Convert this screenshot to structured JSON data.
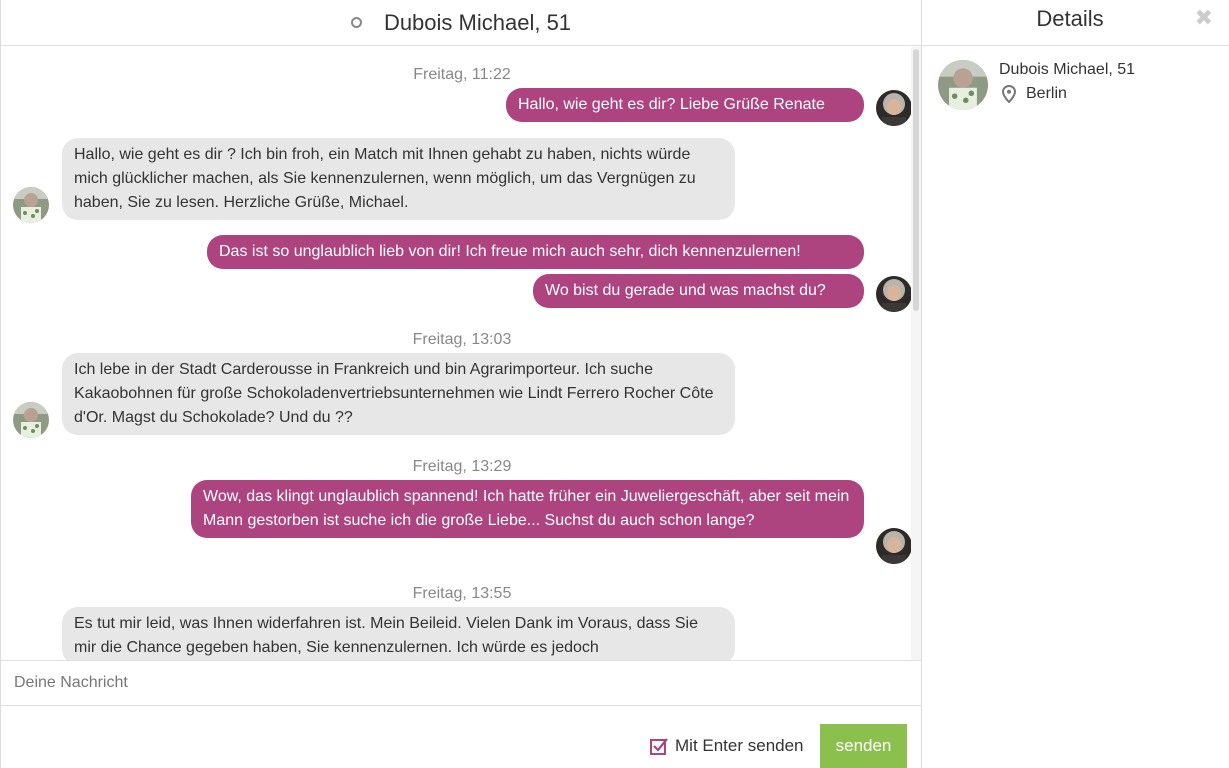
{
  "chat": {
    "title": "Dubois Michael, 51",
    "status_icon": "offline-circle-icon"
  },
  "messages": [
    {
      "type": "timestamp",
      "text": "Freitag, 11:22"
    },
    {
      "type": "outgoing",
      "text": "Hallo, wie geht es dir? Liebe Grüße Renate"
    },
    {
      "type": "incoming",
      "text": "Hallo, wie geht es dir ? Ich bin froh, ein Match mit Ihnen gehabt zu haben, nichts würde mich glücklicher machen, als Sie kennenzulernen, wenn möglich, um das Vergnügen zu haben, Sie zu lesen. Herzliche Grüße, Michael."
    },
    {
      "type": "outgoing",
      "text": "Das ist so unglaublich lieb von dir! Ich freue mich auch sehr, dich kennenzulernen!"
    },
    {
      "type": "outgoing",
      "text": "Wo bist du gerade und was machst du?"
    },
    {
      "type": "timestamp",
      "text": "Freitag, 13:03"
    },
    {
      "type": "incoming",
      "text": "Ich lebe in der Stadt Carderousse in Frankreich und bin Agrarimporteur. Ich suche Kakaobohnen für große Schokoladenvertriebsunternehmen wie Lindt Ferrero Rocher Côte d'Or. Magst du Schokolade? Und du ??"
    },
    {
      "type": "timestamp",
      "text": "Freitag, 13:29"
    },
    {
      "type": "outgoing",
      "text": "Wow, das klingt unglaublich spannend! Ich hatte früher ein Juweliergeschäft, aber seit mein Mann gestorben ist suche ich die große Liebe... Suchst du auch schon lange?"
    },
    {
      "type": "timestamp",
      "text": "Freitag, 13:55"
    },
    {
      "type": "incoming",
      "text": "Es tut mir leid, was Ihnen widerfahren ist. Mein Beileid. Vielen Dank im Voraus, dass Sie mir die Chance gegeben haben, Sie kennenzulernen. Ich würde es jedoch"
    }
  ],
  "compose": {
    "placeholder": "Deine Nachricht",
    "enter_to_send_label": "Mit Enter senden",
    "enter_to_send_checked": true,
    "send_label": "senden"
  },
  "details": {
    "title": "Details",
    "close_icon": "close-icon",
    "name": "Dubois Michael, 51",
    "location": "Berlin",
    "location_icon": "map-pin-icon"
  },
  "colors": {
    "outgoing_bubble": "#ad4480",
    "incoming_bubble": "#e7e7e7",
    "send_button": "#8cc04e",
    "checkbox": "#ad4480"
  }
}
